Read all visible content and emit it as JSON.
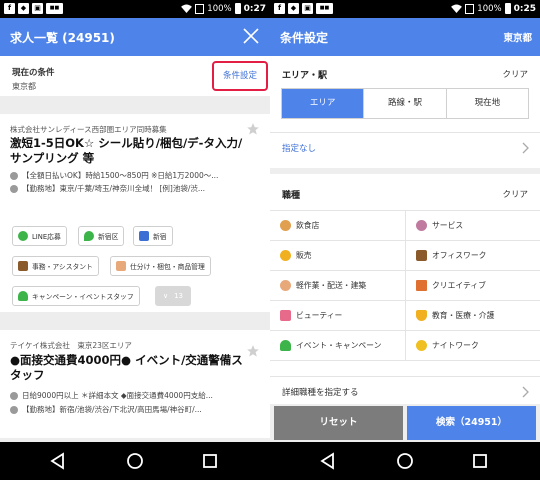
{
  "left": {
    "status": {
      "battery": "100%",
      "time": "0:27"
    },
    "appbar": {
      "title": "求人一覧 (24951)"
    },
    "condition": {
      "label": "現在の条件",
      "value": "東京都",
      "button": "条件設定"
    },
    "jobs": [
      {
        "company": "株式会社サンレディース西部圏エリア同時募集",
        "title": "激短1-5日OK☆ シール貼り/梱包/デ-タ入力/サンプリング 等",
        "pay": "【全額日払いOK】時給1500〜850円 ※日給1万2000〜...",
        "location": "【勤務地】東京/千葉/埼玉/神奈川全域！ [例]池袋/渋..."
      },
      {
        "company": "テイケイ株式会社　東京23区エリア",
        "title": "●面接交通費4000円● イベント/交通警備スタッフ",
        "pay": "日給9000円以上 ＊詳細本文 ◆面接交通費4000円支給...",
        "location": "【勤務地】新宿/池袋/渋谷/下北沢/高田馬場/神谷町/..."
      }
    ],
    "tags": {
      "line": "LINE応募",
      "shinjuku_ku": "新宿区",
      "shinjuku": "新宿",
      "office": "事務・アシスタント",
      "packing": "仕分け・梱包・商品管理",
      "campaign": "キャンペーン・イベントスタッフ",
      "more_count": "13"
    }
  },
  "right": {
    "status": {
      "battery": "100%",
      "time": "0:25"
    },
    "appbar": {
      "title": "条件設定",
      "region": "東京都"
    },
    "area": {
      "header": "エリア・駅",
      "clear": "クリア",
      "tabs": [
        "エリア",
        "路線・駅",
        "現在地"
      ],
      "unspecified": "指定なし"
    },
    "jobtype": {
      "header": "職種",
      "clear": "クリア",
      "items": [
        "飲食店",
        "サービス",
        "販売",
        "オフィスワーク",
        "軽作業・配送・建築",
        "クリエイティブ",
        "ビューティー",
        "教育・医療・介護",
        "イベント・キャンペーン",
        "ナイトワーク"
      ],
      "detail": "詳細職種を指定する"
    },
    "buttons": {
      "reset": "リセット",
      "search": "検索（24951）"
    }
  },
  "colors": {
    "primary": "#4e83ea",
    "highlight": "#e21e45",
    "reset": "#7c7c7c"
  },
  "icons": {
    "close": "close-icon",
    "star": "star-icon",
    "yen": "yen-icon",
    "pin": "location-pin-icon",
    "chevron": "chevron-right-icon",
    "back": "back-icon",
    "home": "home-icon",
    "recent": "recent-apps-icon"
  }
}
